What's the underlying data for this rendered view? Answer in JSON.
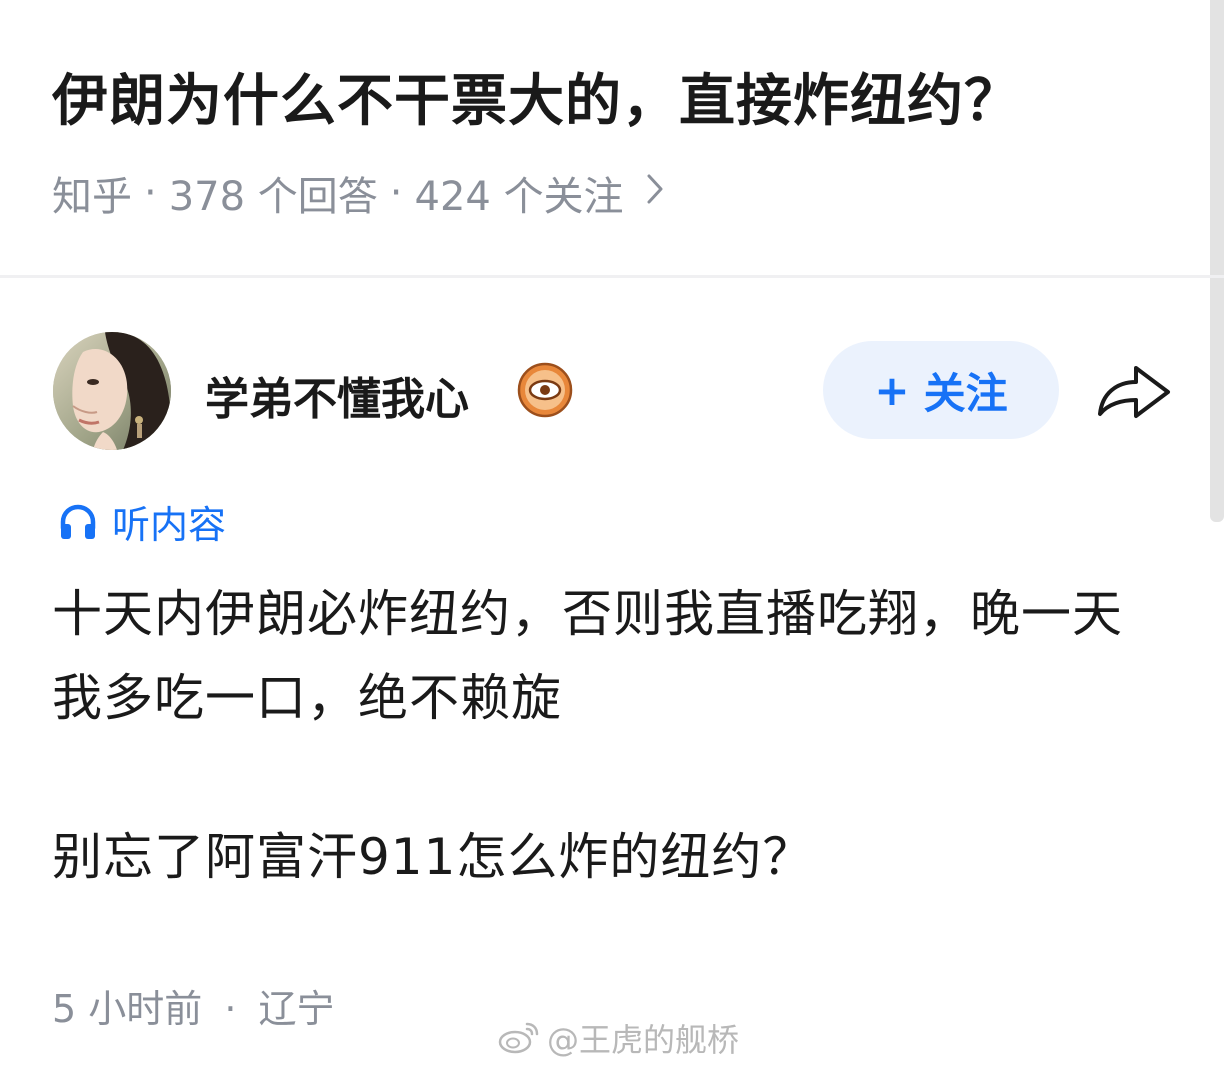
{
  "question": {
    "title": "伊朗为什么不干票大的，直接炸纽约？",
    "source": "知乎",
    "separator": "·",
    "answers_count": "378 个回答",
    "followers_count": "424 个关注",
    "more_icon": "chevron-right-icon"
  },
  "author": {
    "name": "学弟不懂我心",
    "badge_icon": "eye-badge-icon",
    "follow_plus": "+",
    "follow_label": "关注",
    "share_icon": "share-arrow-icon"
  },
  "listen": {
    "icon": "headphones-icon",
    "label": "听内容"
  },
  "answer": {
    "paragraph_1": "十天内伊朗必炸纽约，否则我直播吃翔，晚一天我多吃一口，绝不赖旋",
    "paragraph_2": "别忘了阿富汗911怎么炸的纽约？",
    "time": "5 小时前",
    "separator": "·",
    "location": "辽宁"
  },
  "watermark": {
    "icon": "weibo-icon",
    "text": "@王虎的舰桥"
  },
  "colors": {
    "accent_blue": "#1772f6",
    "follow_bg": "#ebf2fd",
    "meta_gray": "#8a8f99",
    "badge_orange": "#e8873a"
  }
}
